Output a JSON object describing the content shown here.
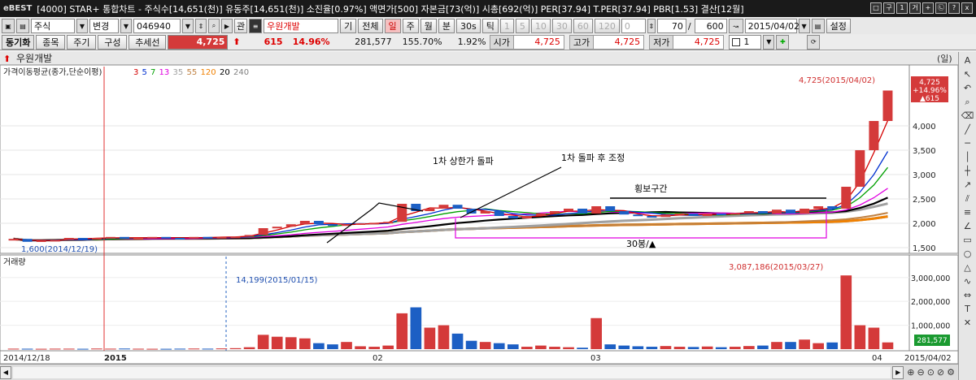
{
  "window": {
    "logo": "eBEST",
    "title": "[4000] STAR+ 통합차트 - 주식수[14,651(천)] 유동주[14,651(천)] 소진율[0.97%] 액면가[500] 자본금[73(억)] 시총[692(억)] PER[37.94] T.PER[37.94] PBR[1.53] 결산[12월]",
    "buttons": [
      "□",
      "구",
      "1",
      "거",
      "+",
      "㉡",
      "?",
      "x"
    ]
  },
  "toolbar": {
    "market": "주식",
    "change": "변경",
    "code": "046940",
    "relation": "관",
    "stock_name": "우원개발",
    "opt_gi": "기",
    "opt_all": "전체",
    "periods": [
      "일",
      "주",
      "월",
      "분",
      "30s",
      "틱"
    ],
    "active_period": "일",
    "nums": [
      "1",
      "5",
      "10",
      "30",
      "60",
      "120",
      "0"
    ],
    "count_a": "70",
    "slash": "/",
    "count_b": "600",
    "date": "2015/04/02",
    "settings": "설정",
    "spin_val": "1"
  },
  "row2": {
    "sync": "동기화",
    "item": "종목",
    "cycle": "주기",
    "compose": "구성",
    "trend": "추세선",
    "price": "4,725",
    "arrow": "⬆",
    "change": "615",
    "rate": "14.96%",
    "volume": "281,577",
    "vol_rate": "155.70%",
    "turnover": "1.92%",
    "open_lbl": "시가",
    "open_val": "4,725",
    "high_lbl": "고가",
    "high_val": "4,725",
    "low_lbl": "저가",
    "low_val": "4,725"
  },
  "chart": {
    "stock_header": "우원개발",
    "unit_label": "(일)",
    "price_panel_title": "가격이동평균(종가,단순이평)",
    "ma_periods": [
      {
        "label": "3",
        "color": "#d40000"
      },
      {
        "label": "5",
        "color": "#0030d0"
      },
      {
        "label": "7",
        "color": "#00a000"
      },
      {
        "label": "13",
        "color": "#e000e0"
      },
      {
        "label": "35",
        "color": "#a0a0a0"
      },
      {
        "label": "55",
        "color": "#c08040"
      },
      {
        "label": "120",
        "color": "#f08000"
      },
      {
        "label": "20",
        "color": "#000000"
      },
      {
        "label": "240",
        "color": "#808080"
      }
    ],
    "price_axis": [
      "4,000",
      "3,500",
      "3,000",
      "2,500",
      "2,000",
      "1,500"
    ],
    "high_annotation": "4,725(2015/04/02)",
    "low_annotation": "1,600(2014/12/19)",
    "badge_price": "4,725",
    "badge_rate": "+14.96%",
    "badge_change": "▲615",
    "annotations": [
      "1차 상한가 돌파",
      "1차 돌파 후 조정",
      "횡보구간",
      "30봉/▲"
    ],
    "volume_panel_title": "거래량",
    "volume_axis": [
      "3,000,000",
      "2,000,000",
      "1,000,000"
    ],
    "vol_high_annotation": "3,087,186(2015/03/27)",
    "vol_mark_annotation": "14,199(2015/01/15)",
    "vol_badge": "281,577",
    "x_labels": [
      "2014/12/18",
      "2015",
      "02",
      "03",
      "04",
      "2015/04/02"
    ]
  },
  "chart_data": {
    "type": "candlestick",
    "price_range": [
      1450,
      4950
    ],
    "volume_range": [
      0,
      3400000
    ],
    "candles": [
      {
        "c": 1680,
        "v": 20000
      },
      {
        "c": 1620,
        "v": 18000
      },
      {
        "c": 1650,
        "v": 15000
      },
      {
        "c": 1660,
        "v": 20000
      },
      {
        "c": 1700,
        "v": 20000
      },
      {
        "c": 1680,
        "v": 15000
      },
      {
        "c": 1700,
        "v": 25000
      },
      {
        "c": 1720,
        "v": 20000
      },
      {
        "c": 1690,
        "v": 25000
      },
      {
        "c": 1700,
        "v": 18000
      },
      {
        "c": 1720,
        "v": 15000
      },
      {
        "c": 1700,
        "v": 14199
      },
      {
        "c": 1690,
        "v": 20000
      },
      {
        "c": 1720,
        "v": 25000
      },
      {
        "c": 1710,
        "v": 20000
      },
      {
        "c": 1720,
        "v": 30000
      },
      {
        "c": 1730,
        "v": 40000
      },
      {
        "c": 1760,
        "v": 80000
      },
      {
        "c": 1900,
        "v": 600000
      },
      {
        "c": 1930,
        "v": 520000
      },
      {
        "c": 1980,
        "v": 500000
      },
      {
        "c": 2050,
        "v": 450000
      },
      {
        "c": 1980,
        "v": 250000
      },
      {
        "c": 1960,
        "v": 200000
      },
      {
        "c": 1980,
        "v": 300000
      },
      {
        "c": 2000,
        "v": 120000
      },
      {
        "c": 2010,
        "v": 100000
      },
      {
        "c": 2030,
        "v": 150000
      },
      {
        "c": 2400,
        "v": 1500000
      },
      {
        "c": 2250,
        "v": 1750000
      },
      {
        "c": 2300,
        "v": 900000
      },
      {
        "c": 2380,
        "v": 1000000
      },
      {
        "c": 2300,
        "v": 650000
      },
      {
        "c": 2200,
        "v": 350000
      },
      {
        "c": 2250,
        "v": 300000
      },
      {
        "c": 2150,
        "v": 250000
      },
      {
        "c": 2100,
        "v": 200000
      },
      {
        "c": 2150,
        "v": 100000
      },
      {
        "c": 2200,
        "v": 150000
      },
      {
        "c": 2250,
        "v": 100000
      },
      {
        "c": 2300,
        "v": 80000
      },
      {
        "c": 2200,
        "v": 60000
      },
      {
        "c": 2350,
        "v": 1300000
      },
      {
        "c": 2250,
        "v": 200000
      },
      {
        "c": 2180,
        "v": 150000
      },
      {
        "c": 2150,
        "v": 120000
      },
      {
        "c": 2130,
        "v": 100000
      },
      {
        "c": 2180,
        "v": 130000
      },
      {
        "c": 2200,
        "v": 100000
      },
      {
        "c": 2150,
        "v": 90000
      },
      {
        "c": 2200,
        "v": 110000
      },
      {
        "c": 2180,
        "v": 80000
      },
      {
        "c": 2210,
        "v": 100000
      },
      {
        "c": 2250,
        "v": 130000
      },
      {
        "c": 2200,
        "v": 150000
      },
      {
        "c": 2280,
        "v": 300000
      },
      {
        "c": 2200,
        "v": 300000
      },
      {
        "c": 2300,
        "v": 400000
      },
      {
        "c": 2350,
        "v": 250000
      },
      {
        "c": 2300,
        "v": 280000
      },
      {
        "c": 2750,
        "v": 3087186
      },
      {
        "c": 3500,
        "v": 1000000
      },
      {
        "c": 4100,
        "v": 900000
      },
      {
        "c": 4725,
        "v": 281577
      }
    ]
  }
}
